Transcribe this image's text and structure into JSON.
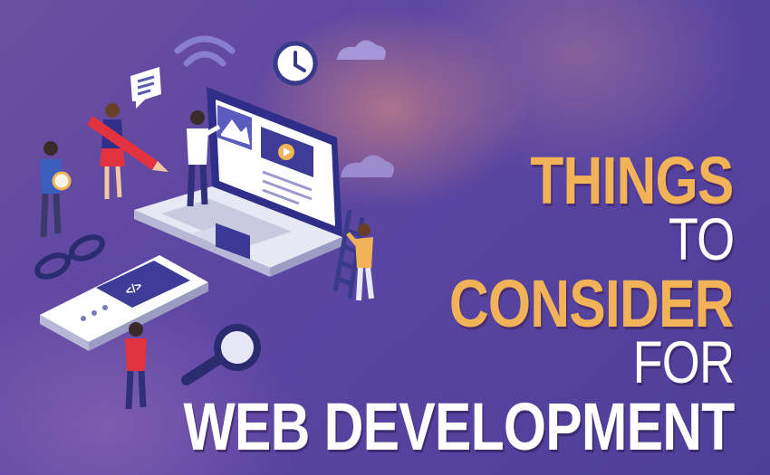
{
  "headline": {
    "line1": "THINGS",
    "line2": "TO",
    "line3": "CONSIDER",
    "line4": "FOR",
    "line5": "WEB DEVELOPMENT"
  },
  "illustration": {
    "laptop_screen_code": "</>",
    "phone_screen_code": "</>",
    "icons": [
      "laptop-icon",
      "smartphone-icon",
      "clock-icon",
      "cloud-icon",
      "wifi-icon",
      "chat-bubble-icon",
      "magnifying-glass-icon",
      "eyeglasses-icon",
      "pencil-icon",
      "ladder-icon",
      "play-icon",
      "image-icon"
    ]
  },
  "colors": {
    "accent_orange": "#f2b257",
    "text_white": "#ffffff",
    "background_purple": "#5a45a3"
  }
}
